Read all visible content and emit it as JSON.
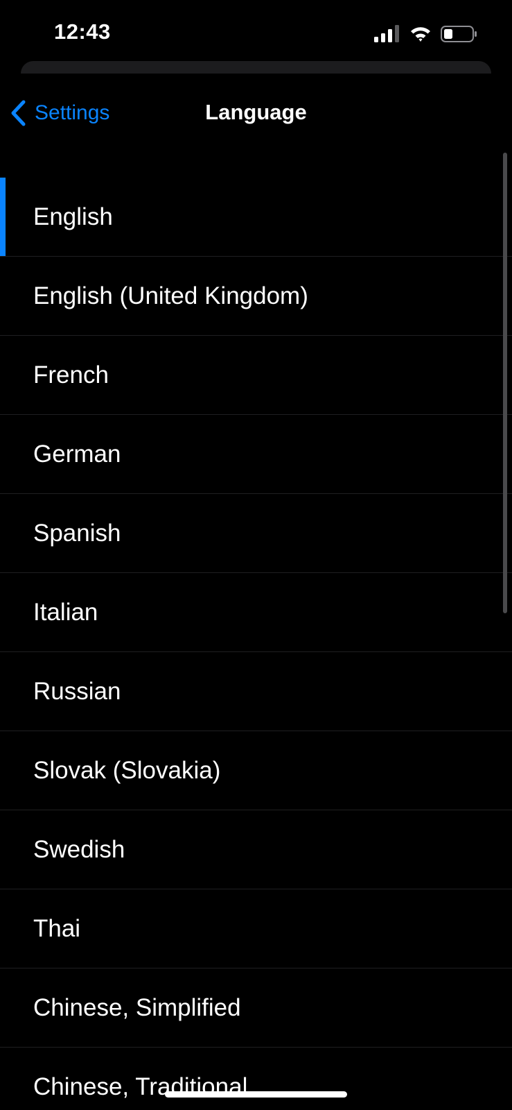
{
  "status_bar": {
    "time": "12:43",
    "icons": [
      "cellular-signal-icon",
      "wifi-icon",
      "battery-icon"
    ]
  },
  "nav": {
    "back_label": "Settings",
    "title": "Language"
  },
  "colors": {
    "accent": "#0a84ff",
    "background": "#000000",
    "separator": "#1f1f21"
  },
  "languages": {
    "selected": "English",
    "items": [
      "English",
      "English (United Kingdom)",
      "French",
      "German",
      "Spanish",
      "Italian",
      "Russian",
      "Slovak (Slovakia)",
      "Swedish",
      "Thai",
      "Chinese, Simplified",
      "Chinese, Traditional"
    ]
  }
}
